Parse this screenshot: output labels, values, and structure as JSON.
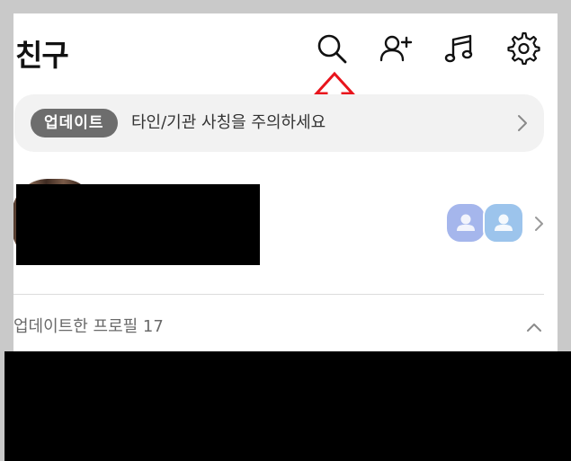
{
  "header": {
    "title": "친구",
    "icons": [
      "search-icon",
      "add-friend-icon",
      "music-icon",
      "settings-icon"
    ]
  },
  "banner": {
    "badge_label": "업데이트",
    "text": "타인/기관 사칭을 주의하세요"
  },
  "updated_profiles": {
    "label": "업데이트한 프로필 17"
  },
  "colors": {
    "annotation_arrow": "#e8141c",
    "badge_bg": "#6d6d6d",
    "banner_bg": "#f2f2f2",
    "friend_icon_1": "#a5b6ec",
    "friend_icon_2": "#9cc4ec"
  }
}
